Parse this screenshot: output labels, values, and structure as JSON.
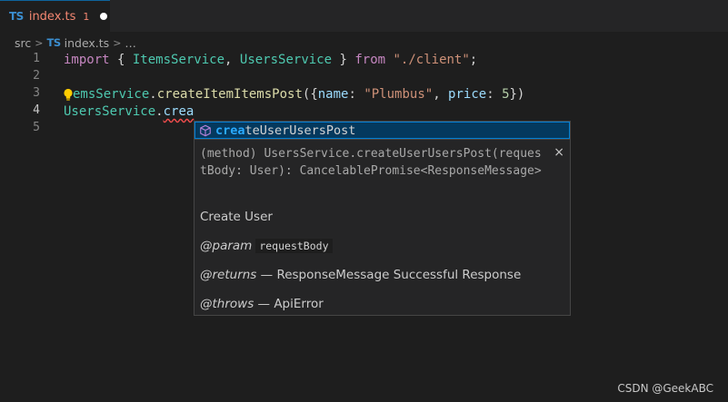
{
  "tab": {
    "lang_badge": "TS",
    "filename": "index.ts",
    "problem_count": "1"
  },
  "breadcrumb": {
    "folder": "src",
    "lang_badge": "TS",
    "file": "index.ts",
    "ellipsis": "…"
  },
  "editor": {
    "line_numbers": [
      "1",
      "2",
      "3",
      "4",
      "5"
    ],
    "active_line": 4,
    "line1": {
      "import_kw": "import",
      "open": " { ",
      "a": "ItemsService",
      "comma": ", ",
      "b": "UsersService",
      "close": " } ",
      "from_kw": "from",
      "space": " ",
      "path": "\"./client\"",
      "semi": ";"
    },
    "line3": {
      "cls": "emsService",
      "dot": ".",
      "method": "createItemItemsPost",
      "open": "({",
      "key1": "name",
      "colon1": ": ",
      "val1": "\"Plumbus\"",
      "comma": ", ",
      "key2": "price",
      "colon2": ": ",
      "val2": "5",
      "close": "})"
    },
    "line4": {
      "cls": "UsersService",
      "dot": ".",
      "partial": "crea"
    }
  },
  "suggest": {
    "icon": "method-cube-icon",
    "match": "crea",
    "rest": "teUserUsersPost"
  },
  "details": {
    "signature": "(method) UsersService.createUserUsersPost(requestBody: User): CancelablePromise<ResponseMessage>",
    "close": "×",
    "summary": "Create User",
    "param_tag": "@param",
    "param_name": "requestBody",
    "returns_tag": "@returns",
    "returns_text": " — ResponseMessage Successful Response",
    "throws_tag": "@throws",
    "throws_text": " — ApiError"
  },
  "watermark": "CSDN @GeekABC",
  "colors": {
    "accent": "#007fd4",
    "match": "#2aaaff",
    "error": "#f48771",
    "keyword": "#c586c0",
    "class": "#4ec9b0",
    "function": "#dcdcaa",
    "string": "#ce9178"
  }
}
